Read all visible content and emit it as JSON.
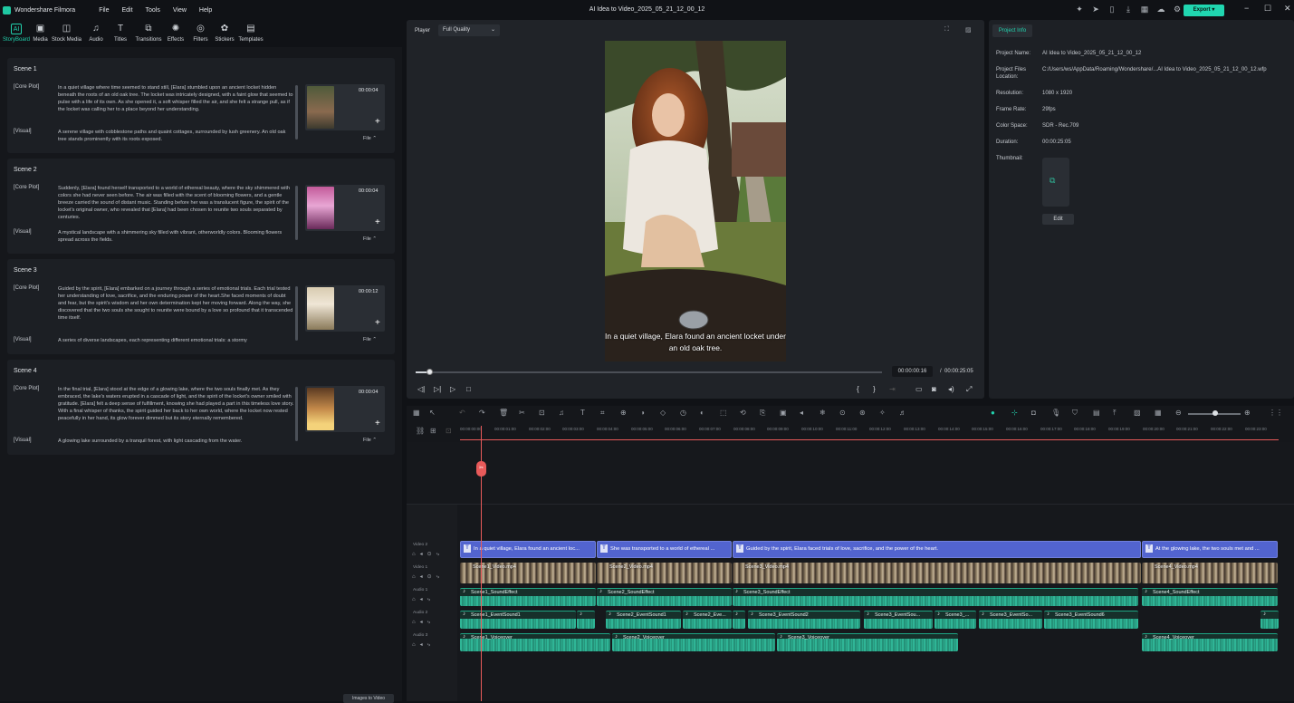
{
  "app": {
    "name": "Wondershare Filmora",
    "window_title": "AI Idea to Video_2025_05_21_12_00_12",
    "export_label": "Export"
  },
  "menu": [
    "File",
    "Edit",
    "Tools",
    "View",
    "Help"
  ],
  "toolbar": [
    "StoryBoard",
    "Media",
    "Stock Media",
    "Audio",
    "Titles",
    "Transitions",
    "Effects",
    "Filters",
    "Stickers",
    "Templates"
  ],
  "scenes": [
    {
      "title": "Scene 1",
      "plot_label": "[Core Plot]",
      "visual_label": "[Visual]",
      "duration": "00:00:04",
      "file_label": "File",
      "plot": "In a quiet village where time seemed to stand still, [Elara] stumbled upon an ancient locket hidden beneath the roots of an old oak tree. The locket was intricately designed, with a faint glow that seemed to pulse with a life of its own. As she opened it, a soft whisper filled the air, and she felt a strange pull, as if the locket was calling her to a place beyond her understanding.",
      "visual": "A serene village with cobblestone paths and quaint cottages, surrounded by lush greenery. An old oak tree stands prominently with its roots exposed."
    },
    {
      "title": "Scene 2",
      "plot_label": "[Core Plot]",
      "visual_label": "[Visual]",
      "duration": "00:00:04",
      "file_label": "File",
      "plot": "Suddenly, [Elara] found herself transported to a world of ethereal beauty, where the sky shimmered with colors she had never seen before. The air was filled with the scent of blooming flowers, and a gentle breeze carried the sound of distant music. Standing before her was a translucent figure, the spirit of the locket's original owner, who revealed that [Elara] had been chosen to reunite two souls separated by centuries.",
      "visual": "A mystical landscape with a shimmering sky filled with vibrant, otherworldly colors. Blooming flowers spread across the fields."
    },
    {
      "title": "Scene 3",
      "plot_label": "[Core Plot]",
      "visual_label": "[Visual]",
      "duration": "00:00:12",
      "file_label": "File",
      "plot": "Guided by the spirit, [Elara] embarked on a journey through a series of emotional trials. Each trial tested her understanding of love, sacrifice, and the enduring power of the heart.She faced moments of doubt and fear, but the spirit's wisdom and her own determination kept her moving forward. Along the way, she discovered that the two souls she sought to reunite were bound by a love so profound that it transcended time itself.",
      "visual": "A series of diverse landscapes, each representing different emotional trials: a stormy"
    },
    {
      "title": "Scene 4",
      "plot_label": "[Core Plot]",
      "visual_label": "[Visual]",
      "duration": "00:00:04",
      "file_label": "File",
      "plot": "In the final trial, [Elara] stood at the edge of a glowing lake, where the two souls finally met. As they embraced, the lake's waters erupted in a cascade of light, and the spirit of the locket's owner smiled with gratitude. [Elara] felt a deep sense of fulfillment, knowing she had played a part in this timeless love story. With a final whisper of thanks, the spirit guided her back to her own world, where the locket now rested peacefully in her hand, its glow forever dimmed but its story eternally remembered.",
      "visual": "A glowing lake surrounded by a tranquil forest, with light cascading from the water."
    }
  ],
  "bottom_button": "Images to Video",
  "player": {
    "label": "Player",
    "quality": "Full Quality",
    "caption": "In a quiet village, Elara found an ancient locket under an old oak tree.",
    "current": "00:00:00:16",
    "separator": "/",
    "total": "00:00:25:05",
    "progress_fraction": 0.03
  },
  "project_info": {
    "tab": "Project Info",
    "rows": [
      {
        "k": "Project Name:",
        "v": "AI Idea to Video_2025_05_21_12_00_12"
      },
      {
        "k": "Project Files Location:",
        "v": "C:/Users/ws/AppData/Roaming/Wondershare/...AI Idea to Video_2025_05_21_12_00_12.wfp"
      },
      {
        "k": "Resolution:",
        "v": "1080 x 1920"
      },
      {
        "k": "Frame Rate:",
        "v": "29fps"
      },
      {
        "k": "Color Space:",
        "v": "SDR - Rec.709"
      },
      {
        "k": "Duration:",
        "v": "00:00:25:05"
      },
      {
        "k": "Thumbnail:",
        "v": ""
      }
    ],
    "edit_label": "Edit"
  },
  "ruler": [
    "00:00:00:00",
    "00:00:01:00",
    "00:00:02:00",
    "00:00:03:00",
    "00:00:04:00",
    "00:00:05:00",
    "00:00:06:00",
    "00:00:07:00",
    "00:00:08:00",
    "00:00:09:00",
    "00:00:10:00",
    "00:00:11:00",
    "00:00:12:00",
    "00:00:13:00",
    "00:00:14:00",
    "00:00:15:00",
    "00:00:16:00",
    "00:00:17:00",
    "00:00:18:00",
    "00:00:19:00",
    "00:00:20:00",
    "00:00:21:00",
    "00:00:22:00",
    "00:00:23:00"
  ],
  "tracks": {
    "names": [
      "Video 2",
      "Video 1",
      "Audio 1",
      "Audio 2",
      "Audio 3"
    ]
  },
  "text_clips": [
    "In a quiet village, Elara found an ancient loc...",
    "She was transported to a world of ethereal ...",
    "Guided by the spirit, Elara faced trials of love, sacrifice, and the power of the heart.",
    "At the glowing lake, the two souls met and ..."
  ],
  "video_clips": [
    "Scene1_Video.mp4",
    "Scene2_Video.mp4",
    "Scene3_Video.mp4",
    "Scene4_Video.mp4"
  ],
  "audio1": [
    "Scene1_SoundEffect",
    "Scene2_SoundEffect",
    "Scene3_SoundEffect",
    "Scene4_SoundEffect"
  ],
  "audio2": [
    "Scene1_EventSound1",
    "",
    "Scene2_EventSound1",
    "Scene2_Eve...",
    "Scene3_EventSound2",
    "Scene3_EventSou...",
    "Scene3_...",
    "Scene3_EventSo...",
    "Scene3_EventSound6",
    ""
  ],
  "audio3": [
    "Scene1_Voiceover",
    "Scene2_Voiceover",
    "Scene3_Voiceover",
    "Scene4_Voiceover"
  ]
}
